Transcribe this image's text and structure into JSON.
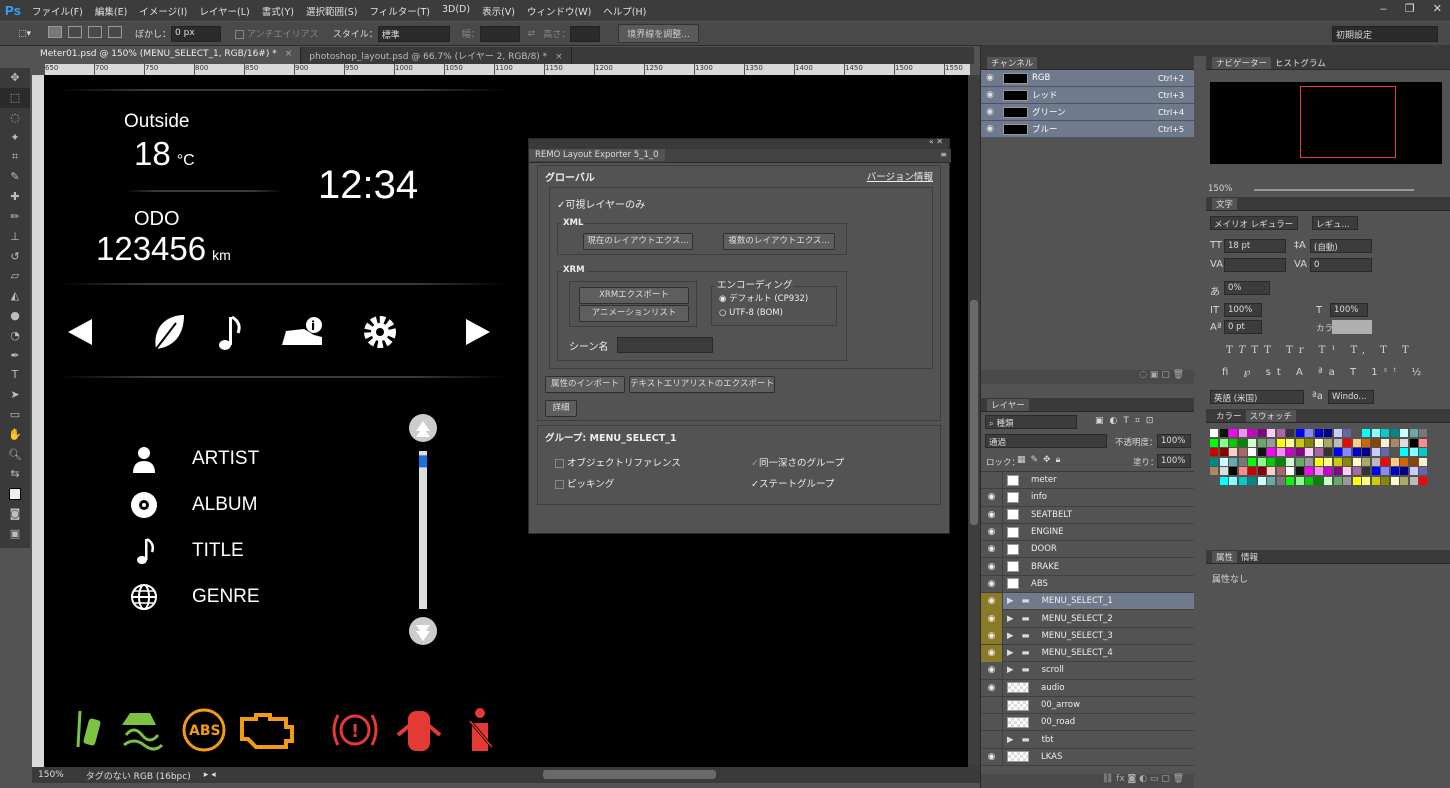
{
  "app": {
    "logo": "Ps",
    "menus": [
      "ファイル(F)",
      "編集(E)",
      "イメージ(I)",
      "レイヤー(L)",
      "書式(Y)",
      "選択範囲(S)",
      "フィルター(T)",
      "3D(D)",
      "表示(V)",
      "ウィンドウ(W)",
      "ヘルプ(H)"
    ]
  },
  "options": {
    "feather_label": "ぼかし：",
    "feather_value": "0 px",
    "antialias": "アンチエイリアス",
    "style_label": "スタイル：",
    "style_value": "標準",
    "width_label": "幅：",
    "height_label": "高さ：",
    "refine_btn": "境界線を調整...",
    "workspace": "初期設定"
  },
  "tabs": [
    {
      "label": "Meter01.psd @ 150% (MENU_SELECT_1, RGB/16#) *"
    },
    {
      "label": "photoshop_layout.psd @ 66.7% (レイヤー 2, RGB/8) *"
    }
  ],
  "ruler_ticks": [
    "650",
    "700",
    "750",
    "800",
    "850",
    "900",
    "950",
    "1000",
    "1050",
    "1100",
    "1150",
    "1200",
    "1250",
    "1300",
    "1350",
    "1400",
    "1450",
    "1500",
    "1550"
  ],
  "status": {
    "zoom": "150%",
    "profile": "タグのない RGB (16bpc)"
  },
  "meter": {
    "outside_label": "Outside",
    "temp_value": "18",
    "temp_unit": "°C",
    "clock": "12:34",
    "odo_label": "ODO",
    "odo_value": "123456",
    "odo_unit": "km",
    "menu": [
      {
        "label": "ARTIST",
        "icon": "person-icon"
      },
      {
        "label": "ALBUM",
        "icon": "disc-icon"
      },
      {
        "label": "TITLE",
        "icon": "music-note-icon"
      },
      {
        "label": "GENRE",
        "icon": "globe-icon"
      }
    ],
    "scroll_position": 0.03
  },
  "dialog": {
    "tab": "REMO Layout Exporter 5_1_0",
    "global": "グローバル",
    "version_link": "バージョン情報",
    "visible_only": "可視レイヤーのみ",
    "xml": "XML",
    "xml_current": "現在のレイアウトエクス...",
    "xml_multi": "複数のレイアウトエクス...",
    "xrm": "XRM",
    "xrm_export": "XRMエクスポート",
    "anim_list": "アニメーションリスト",
    "encoding": "エンコーディング",
    "enc_default": "デフォルト (CP932)",
    "enc_utf8": "UTF-8 (BOM)",
    "scene_name": "シーン名",
    "import_props": "属性のインポート",
    "export_text": "テキストエリアリストのエクスポート",
    "details": "詳細",
    "group_label": "グループ: MENU_SELECT_1",
    "obj_ref": "オブジェクトリファレンス",
    "same_depth": "同一深さのグループ",
    "picking": "ピッキング",
    "state_group": "ステートグループ"
  },
  "channels": {
    "title": "チャンネル",
    "rows": [
      {
        "name": "RGB",
        "key": "Ctrl+2"
      },
      {
        "name": "レッド",
        "key": "Ctrl+3"
      },
      {
        "name": "グリーン",
        "key": "Ctrl+4"
      },
      {
        "name": "ブルー",
        "key": "Ctrl+5"
      }
    ]
  },
  "layers": {
    "title": "レイヤー",
    "kind": "種類",
    "blend": "通過",
    "opacity_label": "不透明度：",
    "opacity": "100%",
    "lock_label": "ロック：",
    "fill_label": "塗り：",
    "fill": "100%",
    "rows": [
      {
        "name": "meter",
        "type": "smart",
        "eye": false
      },
      {
        "name": "info",
        "type": "smart",
        "eye": true
      },
      {
        "name": "SEATBELT",
        "type": "smart",
        "eye": true
      },
      {
        "name": "ENGINE",
        "type": "smart",
        "eye": true
      },
      {
        "name": "DOOR",
        "type": "smart",
        "eye": true
      },
      {
        "name": "BRAKE",
        "type": "smart",
        "eye": true
      },
      {
        "name": "ABS",
        "type": "smart",
        "eye": true
      },
      {
        "name": "MENU_SELECT_1",
        "type": "folder",
        "eye": true,
        "hl": true,
        "sel": true
      },
      {
        "name": "MENU_SELECT_2",
        "type": "folder",
        "eye": true,
        "hl": true
      },
      {
        "name": "MENU_SELECT_3",
        "type": "folder",
        "eye": true,
        "hl": true
      },
      {
        "name": "MENU_SELECT_4",
        "type": "folder",
        "eye": true,
        "hl": true
      },
      {
        "name": "scroll",
        "type": "folder",
        "eye": true
      },
      {
        "name": "audio",
        "type": "pixel",
        "eye": true
      },
      {
        "name": "00_arrow",
        "type": "pixel",
        "eye": false
      },
      {
        "name": "00_road",
        "type": "pixel",
        "eye": false
      },
      {
        "name": "tbt",
        "type": "folder",
        "eye": false
      },
      {
        "name": "LKAS",
        "type": "pixel",
        "eye": true
      }
    ]
  },
  "navigator": {
    "tabs": [
      "ナビゲーター",
      "ヒストグラム"
    ],
    "zoom": "150%"
  },
  "type": {
    "title": "文字",
    "font": "メイリオ レギュラー",
    "style": "レギュ...",
    "size": "18 pt",
    "leading": "(自動)",
    "tracking": "0",
    "scale": "0%",
    "vscale": "100%",
    "hscale": "100%",
    "baseline": "0 pt",
    "color_label": "カラー：",
    "lang": "英語 (米国)",
    "aa": "Windo..."
  },
  "swatches": {
    "tabs": [
      "カラー",
      "スウォッチ"
    ]
  },
  "properties": {
    "tabs": [
      "属性",
      "情報"
    ],
    "text": "属性なし"
  },
  "colors": {
    "accent": "#31a8ff",
    "selection": "#6f7b8c",
    "highlight": "#8a7a25"
  }
}
